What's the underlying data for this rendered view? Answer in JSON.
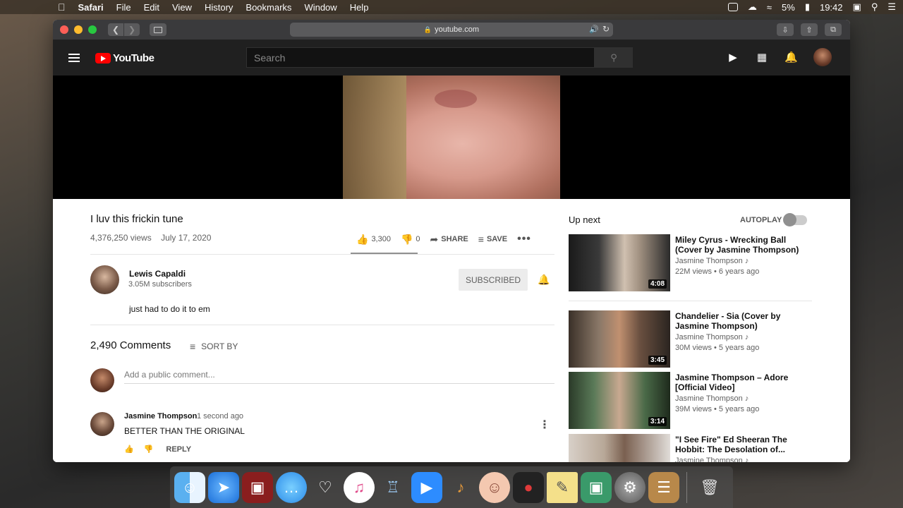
{
  "menubar": {
    "apple": "",
    "app": "Safari",
    "items": [
      "File",
      "Edit",
      "View",
      "History",
      "Bookmarks",
      "Window",
      "Help"
    ],
    "battery": "5%",
    "time": "19:42"
  },
  "browser": {
    "url": "youtube.com"
  },
  "youtube": {
    "logo_text": "YouTube",
    "search_placeholder": "Search"
  },
  "video": {
    "title": "I luv this frickin tune",
    "views": "4,376,250 views",
    "date": "July 17, 2020",
    "likes": "3,300",
    "dislikes": "0",
    "share_label": "SHARE",
    "save_label": "SAVE",
    "more_label": "•••"
  },
  "channel": {
    "name": "Lewis Capaldi",
    "subscribers": "3.05M subscribers",
    "subscribe_label": "SUBSCRIBED",
    "description": "just had to do it to em"
  },
  "comments": {
    "count": "2,490 Comments",
    "sort_label": "SORT BY",
    "add_placeholder": "Add a public comment...",
    "items": [
      {
        "author": "Jasmine Thompson",
        "time": "1 second ago",
        "text": "BETTER THAN THE ORIGINAL",
        "reply_label": "REPLY"
      }
    ]
  },
  "upnext": {
    "heading": "Up next",
    "autoplay_label": "AUTOPLAY",
    "autoplay_on": false,
    "items": [
      {
        "title": "Miley Cyrus - Wrecking Ball (Cover by Jasmine Thompson)",
        "channel": "Jasmine Thompson",
        "views": "22M views • 6 years ago",
        "duration": "4:08"
      },
      {
        "title": "Chandelier - Sia (Cover by Jasmine Thompson)",
        "channel": "Jasmine Thompson",
        "views": "30M views • 5 years ago",
        "duration": "3:45"
      },
      {
        "title": "Jasmine Thompson – Adore [Official Video]",
        "channel": "Jasmine Thompson",
        "views": "39M views • 5 years ago",
        "duration": "3:14"
      },
      {
        "title": "\"I See Fire\" Ed Sheeran The Hobbit: The Desolation of...",
        "channel": "Jasmine Thompson",
        "views": "",
        "duration": ""
      }
    ]
  },
  "dock": {
    "apps": [
      "finder-icon",
      "safari-icon",
      "photo-booth-icon",
      "messages-icon",
      "inkscape-icon",
      "itunes-icon",
      "sequel-pro-icon",
      "zoom-icon",
      "garageband-icon",
      "face-app-icon",
      "music-app-icon",
      "stickies-icon",
      "preview-icon",
      "system-preferences-icon",
      "contacts-icon",
      "trash-icon"
    ]
  }
}
